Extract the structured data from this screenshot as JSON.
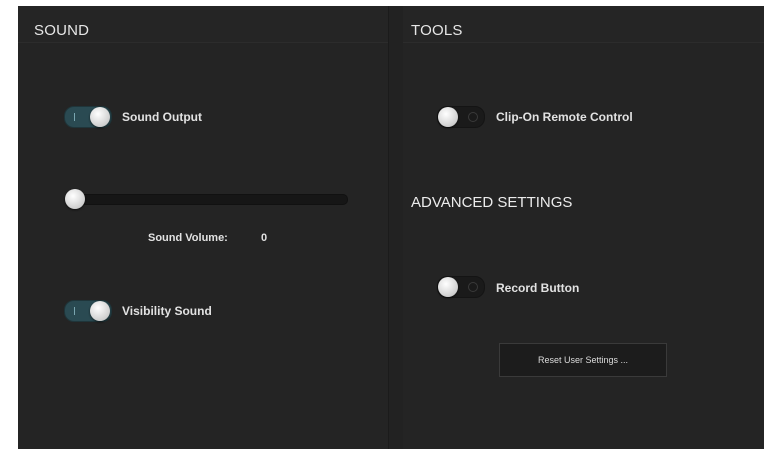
{
  "sound": {
    "header": "SOUND",
    "sound_output": {
      "label": "Sound Output",
      "state": "on"
    },
    "volume": {
      "label": "Sound Volume:",
      "value": "0",
      "level": 0
    },
    "visibility_sound": {
      "label": "Visibility Sound",
      "state": "on"
    }
  },
  "tools": {
    "header": "TOOLS",
    "clip_on_remote": {
      "label": "Clip-On Remote Control",
      "state": "off"
    }
  },
  "advanced": {
    "title": "ADVANCED SETTINGS",
    "record_button": {
      "label": "Record Button",
      "state": "off"
    },
    "reset_label": "Reset User Settings ..."
  },
  "colors": {
    "background": "#222222",
    "toggle_on": "#2a4a52",
    "toggle_off": "#1a1a1a",
    "text": "#e2e2e2"
  }
}
